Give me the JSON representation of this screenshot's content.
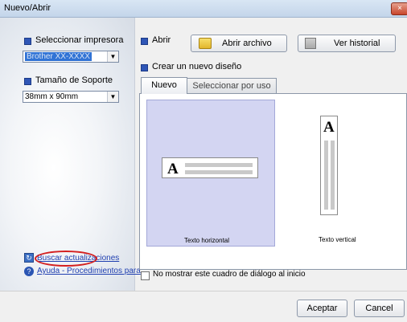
{
  "window": {
    "title": "Nuevo/Abrir",
    "close_label": "×"
  },
  "left": {
    "printer_label": "Seleccionar impresora",
    "printer_value": "Brother XX-XXXX",
    "media_label": "Tamaño de Soporte",
    "media_value": "38mm x 90mm",
    "updates_link": "Buscar actualizaciones",
    "help_link": "Ayuda - Procedimientos para"
  },
  "options": {
    "open_label": "Abrir",
    "open_file_button": "Abrir archivo",
    "history_button": "Ver historial",
    "new_design_label": "Crear un nuevo diseño"
  },
  "tabs": [
    {
      "label": "Nuevo"
    },
    {
      "label": "Seleccionar por uso"
    }
  ],
  "templates": [
    {
      "label": "Texto horizontal",
      "glyph": "A"
    },
    {
      "label": "Texto vertical",
      "glyph": "A"
    }
  ],
  "footer": {
    "dont_show_label": "No mostrar este cuadro de diálogo al inicio",
    "ok_button": "Aceptar",
    "cancel_button": "Cancel"
  },
  "colors": {
    "accent": "#2f56b6",
    "selection": "#d3d5f2",
    "annotation": "#d42020"
  }
}
